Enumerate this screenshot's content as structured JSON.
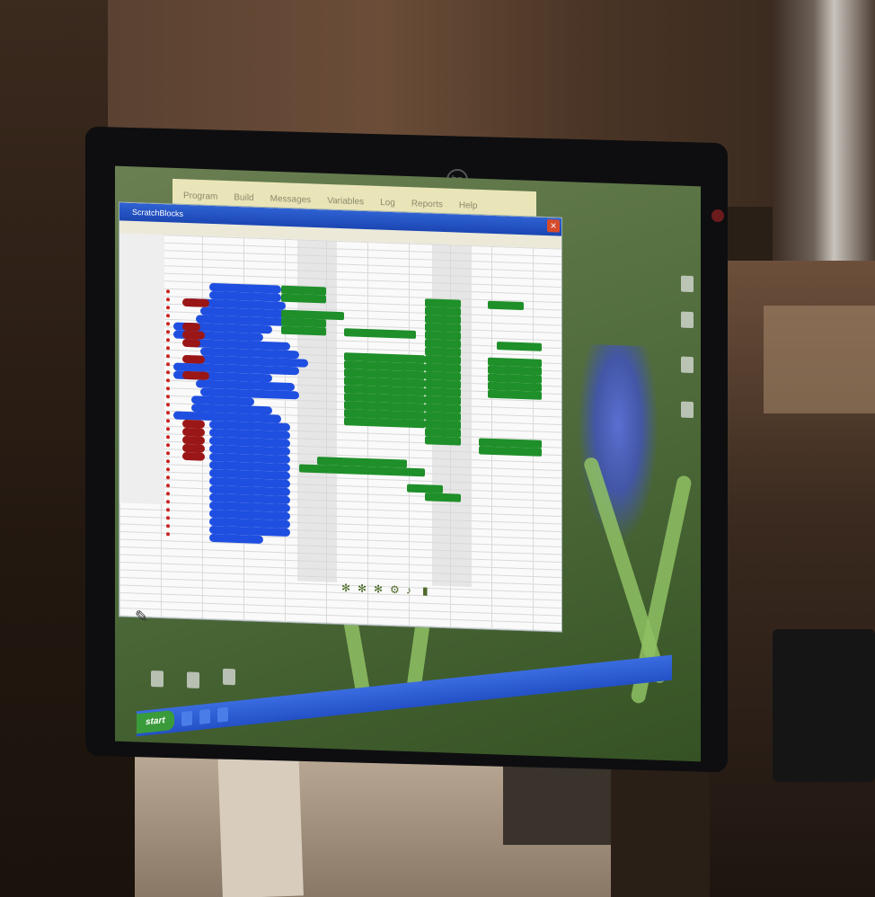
{
  "monitor": {
    "brand": "hp"
  },
  "top_toolbar": {
    "items": [
      "Program",
      "Build",
      "Messages",
      "Variables",
      "Log",
      "Reports",
      "Help"
    ]
  },
  "app_window": {
    "title": "ScratchBlocks",
    "close": "✕"
  },
  "taskbar": {
    "start_label": "start",
    "items": [
      "",
      "",
      ""
    ]
  },
  "colors": {
    "block_blue": "#1f4fe0",
    "block_green": "#1f8f2a",
    "block_red": "#9b1616",
    "titlebar_blue": "#2f62d3",
    "taskbar_blue": "#2450c6"
  },
  "icons": [
    "pencil-icon",
    "snowflake-icon",
    "gear-icon",
    "bell-icon",
    "rectangle-icon"
  ]
}
